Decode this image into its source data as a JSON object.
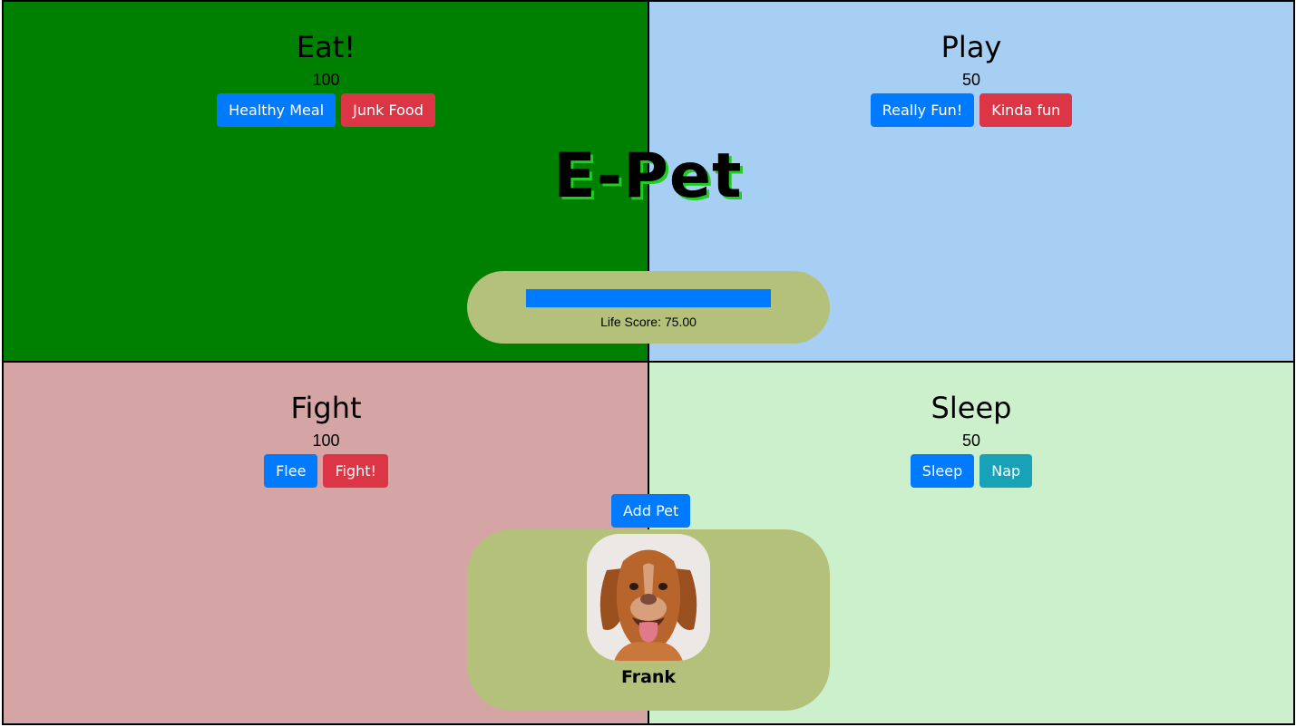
{
  "app": {
    "title": "E-Pet"
  },
  "eat": {
    "title": "Eat!",
    "value": "100",
    "buttons": [
      "Healthy Meal",
      "Junk Food"
    ]
  },
  "play": {
    "title": "Play",
    "value": "50",
    "buttons": [
      "Really Fun!",
      "Kinda fun"
    ]
  },
  "fight": {
    "title": "Fight",
    "value": "100",
    "buttons": [
      "Flee",
      "Fight!"
    ]
  },
  "sleep": {
    "title": "Sleep",
    "value": "50",
    "buttons": [
      "Sleep",
      "Nap"
    ]
  },
  "life": {
    "label": "Life Score: 75.00",
    "progress_fraction": 1.0
  },
  "add_pet_label": "Add Pet",
  "pet": {
    "name": "Frank",
    "photo_icon": "dog-photo"
  },
  "colors": {
    "eat_bg": "#008000",
    "play_bg": "#a6cff3",
    "fight_bg": "#d5a5a5",
    "sleep_bg": "#ccefcc",
    "panel_bg": "#b3c17a",
    "primary": "#007bff",
    "danger": "#dc3545",
    "info": "#17a2b8",
    "title_shadow": "#22cc22"
  }
}
